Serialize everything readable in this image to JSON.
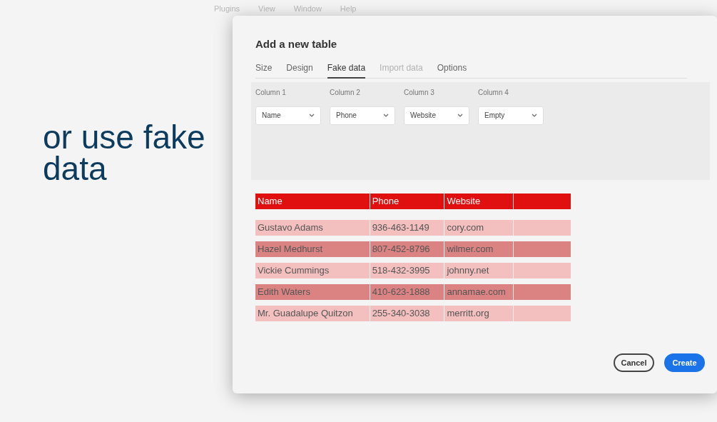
{
  "background_menu": [
    "Plugins",
    "View",
    "Window",
    "Help"
  ],
  "headline": "or use fake data",
  "dialog": {
    "title": "Add a new table",
    "tabs": [
      {
        "label": "Size",
        "selected": false,
        "disabled": false
      },
      {
        "label": "Design",
        "selected": false,
        "disabled": false
      },
      {
        "label": "Fake data",
        "selected": true,
        "disabled": false
      },
      {
        "label": "Import data",
        "selected": false,
        "disabled": true
      },
      {
        "label": "Options",
        "selected": false,
        "disabled": false
      }
    ],
    "columns": [
      {
        "label": "Column 1",
        "value": "Name"
      },
      {
        "label": "Column 2",
        "value": "Phone"
      },
      {
        "label": "Column 3",
        "value": "Website"
      },
      {
        "label": "Column 4",
        "value": "Empty"
      }
    ],
    "table": {
      "columns": [
        "Name",
        "Phone",
        "Website",
        ""
      ],
      "rows": [
        {
          "kind": "light",
          "cells": [
            "Gustavo Adams",
            "936-463-1149",
            "cory.com",
            ""
          ]
        },
        {
          "kind": "dark",
          "cells": [
            "Hazel Medhurst",
            "807-452-8796",
            "wilmer.com",
            ""
          ]
        },
        {
          "kind": "light",
          "cells": [
            "Vickie Cummings",
            "518-432-3995",
            "johnny.net",
            ""
          ]
        },
        {
          "kind": "dark",
          "cells": [
            "Edith Waters",
            "410-623-1888",
            "annamae.com",
            ""
          ]
        },
        {
          "kind": "light",
          "cells": [
            "Mr. Guadalupe Quitzon",
            "255-340-3038",
            "merritt.org",
            ""
          ]
        }
      ]
    },
    "buttons": [
      {
        "kind": "secondary",
        "label": "Cancel"
      },
      {
        "kind": "primary",
        "label": "Create"
      }
    ]
  }
}
